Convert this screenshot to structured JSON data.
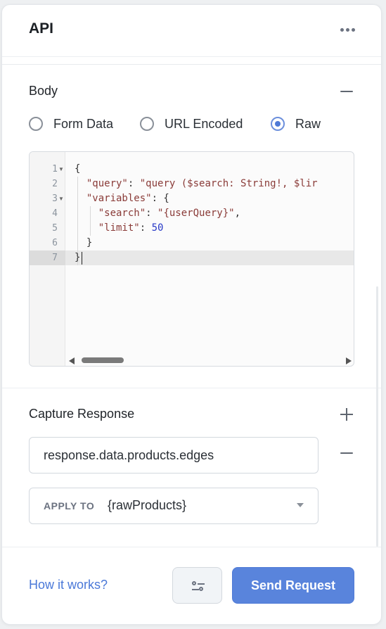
{
  "header": {
    "title": "API",
    "more_icon": "more-horizontal-icon"
  },
  "body": {
    "title": "Body",
    "collapse_icon": "minus-icon",
    "radio_options": [
      {
        "label": "Form Data",
        "checked": false
      },
      {
        "label": "URL Encoded",
        "checked": false
      },
      {
        "label": "Raw",
        "checked": true
      }
    ],
    "editor": {
      "line_numbers": [
        "1",
        "2",
        "3",
        "4",
        "5",
        "6",
        "7"
      ],
      "lines": [
        "{",
        "  \"query\": \"query ($search: String!, $lir",
        "  \"variables\": {",
        "    \"search\": \"{userQuery}\",",
        "    \"limit\": 50",
        "  }",
        "}"
      ],
      "tokens": {
        "l1_brace": "{",
        "l2_key": "\"query\"",
        "l2_colon": ": ",
        "l2_val": "\"query ($search: String!, $lir",
        "l3_key": "\"variables\"",
        "l3_rest": ": {",
        "l4_key": "\"search\"",
        "l4_colon": ": ",
        "l4_val": "\"{userQuery}\"",
        "l4_comma": ",",
        "l5_key": "\"limit\"",
        "l5_colon": ": ",
        "l5_val": "50",
        "l6_brace": "}",
        "l7_brace": "}"
      },
      "active_line": 7
    }
  },
  "capture": {
    "title": "Capture Response",
    "add_icon": "plus-icon",
    "remove_icon": "minus-icon",
    "path_value": "response.data.products.edges",
    "apply_to_label": "APPLY TO",
    "apply_to_value": "{rawProducts}"
  },
  "footer": {
    "how_it_works": "How it works?",
    "settings_icon": "sliders-icon",
    "send_label": "Send Request"
  },
  "colors": {
    "accent": "#5984dc",
    "link": "#4a78d8",
    "string_token": "#8a3b38",
    "number_token": "#2839c7"
  }
}
